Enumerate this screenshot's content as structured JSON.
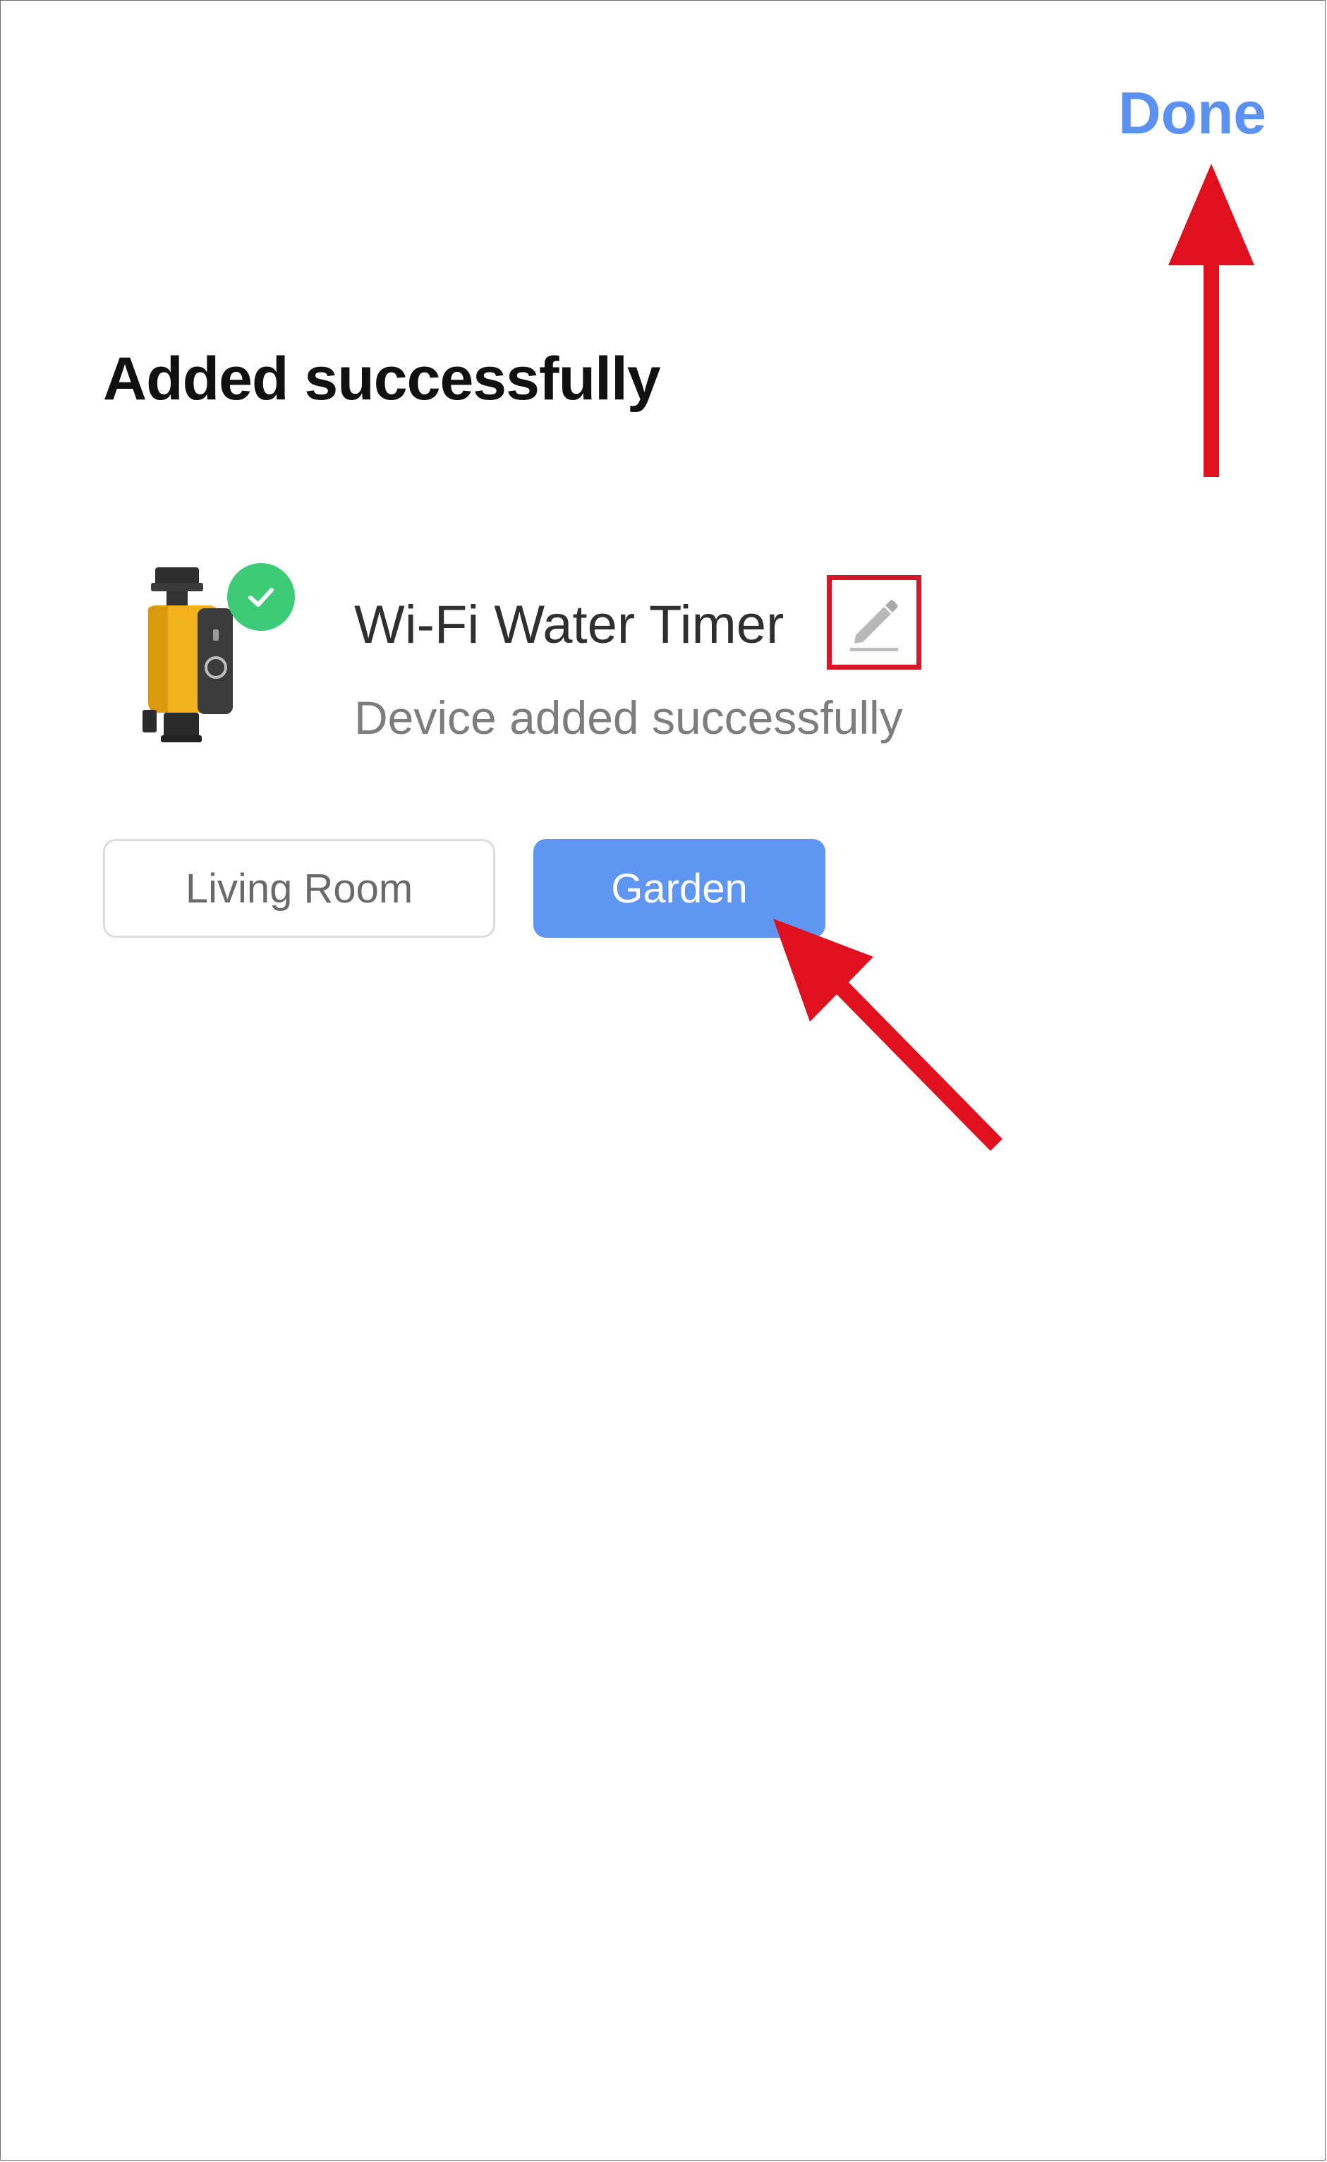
{
  "header": {
    "done_label": "Done"
  },
  "page": {
    "title": "Added successfully"
  },
  "device": {
    "name": "Wi-Fi Water Timer",
    "status": "Device added successfully",
    "image_icon": "water-timer-device",
    "badge_icon": "check-icon",
    "edit_icon": "pencil-icon"
  },
  "rooms": {
    "items": [
      {
        "label": "Living Room",
        "selected": false
      },
      {
        "label": "Garden",
        "selected": true
      }
    ]
  },
  "colors": {
    "accent": "#5b92f2",
    "selected_room": "#5f96f2",
    "success_badge": "#3ecb78",
    "annotation_red": "#d8162a"
  }
}
